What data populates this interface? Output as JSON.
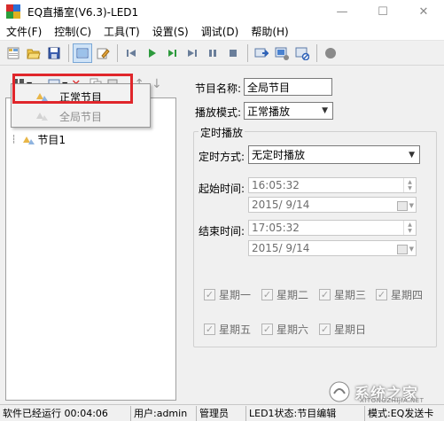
{
  "window": {
    "title": "EQ直播室(V6.3)-LED1",
    "minimize": "—",
    "maximize": "☐",
    "close": "✕"
  },
  "menu": [
    {
      "label": "文件(F)"
    },
    {
      "label": "控制(C)"
    },
    {
      "label": "工具(T)"
    },
    {
      "label": "设置(S)"
    },
    {
      "label": "调试(D)"
    },
    {
      "label": "帮助(H)"
    }
  ],
  "toolbar": {
    "icons": [
      "new-icon",
      "open-folder-icon",
      "save-icon",
      "display-window-icon",
      "edit-icon",
      "first-icon",
      "play-icon",
      "play-step-icon",
      "next-icon",
      "pause-icon",
      "stop-icon",
      "send-icon",
      "send-config-icon",
      "send-disable-icon",
      "record-icon"
    ]
  },
  "tree": {
    "program_label": "节目1"
  },
  "popup": {
    "items": [
      {
        "label": "正常节目",
        "enabled": true
      },
      {
        "label": "全局节目",
        "enabled": false
      }
    ]
  },
  "form": {
    "name_label": "节目名称:",
    "name_value": "全局节目",
    "mode_label": "播放模式:",
    "mode_value": "正常播放",
    "timer_group_title": "定时播放",
    "timer_mode_label": "定时方式:",
    "timer_mode_value": "无定时播放",
    "start_label": "起始时间:",
    "start_time": "16:05:32",
    "start_date": "2015/  9/14",
    "end_label": "结束时间:",
    "end_time": "17:05:32",
    "end_date": "2015/  9/14",
    "weekdays": [
      "星期一",
      "星期二",
      "星期三",
      "星期四",
      "星期五",
      "星期六",
      "星期日"
    ]
  },
  "status": {
    "runtime": "软件已经运行 00:04:06",
    "user": "用户:admin",
    "role": "管理员",
    "led_state": "LED1状态:节目编辑",
    "mode": "模式:EQ发送卡"
  },
  "watermark": {
    "text": "系统之家",
    "sub": "XITONGZHIJIA.NET"
  },
  "colors": {
    "highlight": "#e0262b",
    "active_tool": "#cfe3f7"
  }
}
